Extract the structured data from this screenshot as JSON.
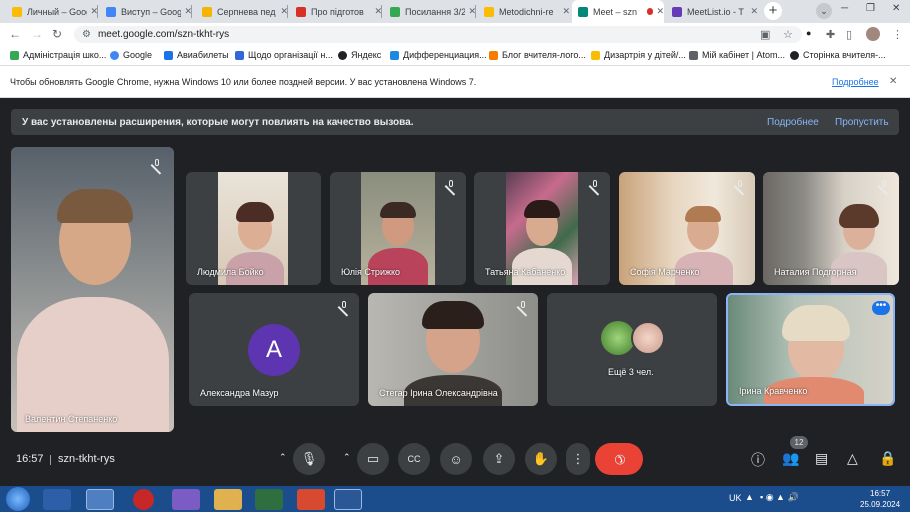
{
  "tabs": [
    {
      "title": "Личный – Google Диск",
      "color": "#fbbc04"
    },
    {
      "title": "Виступ – Google",
      "color": "#4285f4"
    },
    {
      "title": "Серпнева пед",
      "color": "#f4b400"
    },
    {
      "title": "Про підготов",
      "color": "#d93025"
    },
    {
      "title": "Посилання 3/2",
      "color": "#34a853"
    },
    {
      "title": "Metodichni-re",
      "color": "#fbbc04"
    },
    {
      "title": "Meet – szn",
      "color": "#00897b"
    },
    {
      "title": "MeetList.io - T",
      "color": "#673ab7"
    }
  ],
  "address": {
    "url": "meet.google.com/szn-tkht-rys"
  },
  "bookmarks": [
    {
      "label": "Адміністрація шко...",
      "color": "#34a853"
    },
    {
      "label": "Google",
      "color": "#4285f4"
    },
    {
      "label": "Авиабилеты",
      "color": "#1a73e8"
    },
    {
      "label": "Щодо організації н...",
      "color": "#3367d6"
    },
    {
      "label": "Яндекс",
      "color": "#202124"
    },
    {
      "label": "Дифференциация...",
      "color": "#1e88e5"
    },
    {
      "label": "Блог вчителя-лого...",
      "color": "#f57c00"
    },
    {
      "label": "Дизартрія у дітей/...",
      "color": "#fbbc04"
    },
    {
      "label": "Мій кабінет | Atom...",
      "color": "#5f6368"
    },
    {
      "label": "Сторінка вчителя-...",
      "color": "#202124"
    }
  ],
  "infobar": {
    "message": "Чтобы обновлять Google Chrome, нужна Windows 10 или более поздней версии. У вас установлена Windows 7.",
    "link": "Подробнее"
  },
  "banner": {
    "message": "У вас установлены расширения, которые могут повлиять на качество вызова.",
    "more": "Подробнее",
    "skip": "Пропустить"
  },
  "participants": {
    "p1": "Валентин Степаненко",
    "p2": "Людмила Бойко",
    "p3": "Юлія Стрижко",
    "p4": "Татьяна Кабаненко",
    "p5": "Софія Марченко",
    "p6": "Наталия Подгорная",
    "p7": "Александра Мазур",
    "p7_initial": "A",
    "p8": "Стегар Ірина Олександрівна",
    "p9": "Ещё 3 чел.",
    "p10": "Ірина Кравченко"
  },
  "meeting": {
    "time": "16:57",
    "code": "szn-tkht-rys",
    "people_count": "12"
  },
  "taskbar": {
    "lang": "UK",
    "time": "16:57",
    "date": "25.09.2024"
  }
}
